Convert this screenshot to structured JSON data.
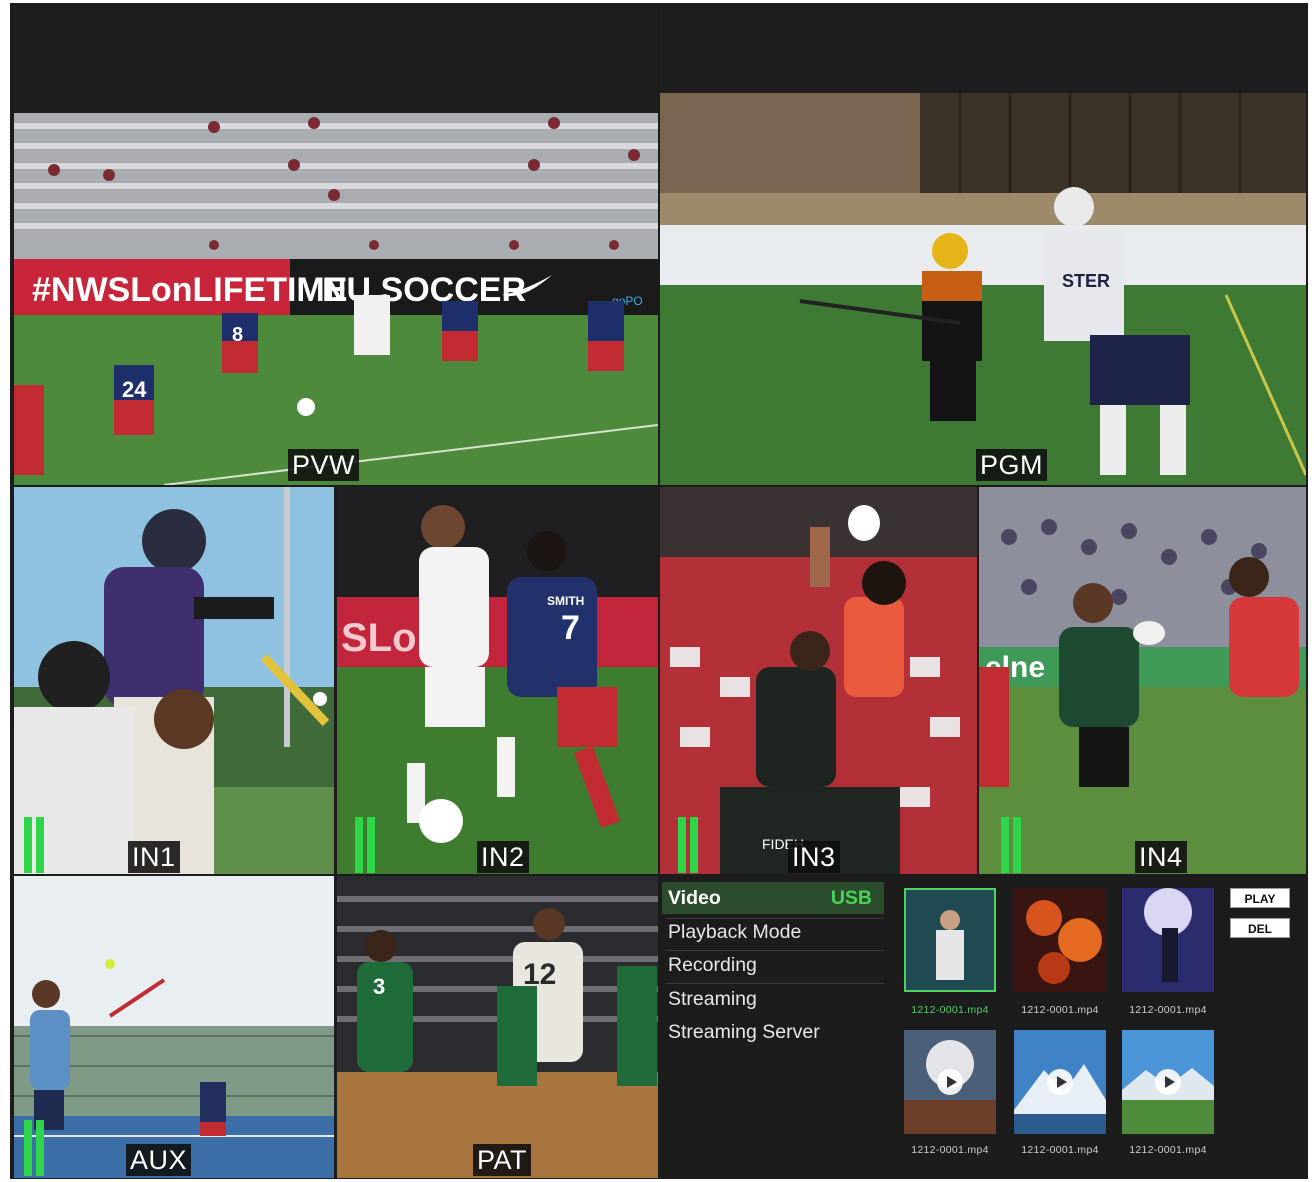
{
  "panes": {
    "pvw": {
      "label": "PVW"
    },
    "pgm": {
      "label": "PGM"
    },
    "in1": {
      "label": "IN1"
    },
    "in2": {
      "label": "IN2"
    },
    "in3": {
      "label": "IN3"
    },
    "in4": {
      "label": "IN4"
    },
    "aux": {
      "label": "AUX"
    },
    "pat": {
      "label": "PAT"
    }
  },
  "scene_text": {
    "banner": "#NWSLonLIFETIME",
    "nike_board": "NU SOCCER",
    "gopo": "goPO",
    "lacrosse_jersey": "STER",
    "in2_board": "SLon",
    "jersey_smith": "SMITH",
    "jersey_7": "7",
    "jersey_8": "8",
    "jersey_24": "24",
    "jersey_12": "12",
    "jersey_3": "3",
    "in4_board": "elne",
    "fide": "FIDEH"
  },
  "menu": {
    "items": [
      {
        "label": "Video",
        "badge": "USB",
        "active": true
      },
      {
        "label": "Playback Mode"
      },
      {
        "label": "Recording"
      },
      {
        "label": "Streaming"
      },
      {
        "label": "Streaming Server"
      }
    ]
  },
  "files": [
    {
      "name": "1212-0001.mp4",
      "selected": true,
      "icon": "concert-thumbnail"
    },
    {
      "name": "1212-0001.mp4",
      "icon": "fireworks-thumbnail"
    },
    {
      "name": "1212-0001.mp4",
      "icon": "stage-thumbnail"
    },
    {
      "name": "1212-0001.mp4",
      "icon": "moon-thumbnail"
    },
    {
      "name": "1212-0001.mp4",
      "icon": "mountain-thumbnail"
    },
    {
      "name": "1212-0001.mp4",
      "icon": "landscape-thumbnail"
    }
  ],
  "buttons": {
    "play": "PLAY",
    "del": "DEL"
  },
  "colors": {
    "accent_green": "#4fd163",
    "meter_green": "#2fd64a",
    "panel_bg": "#1c1c1c"
  }
}
